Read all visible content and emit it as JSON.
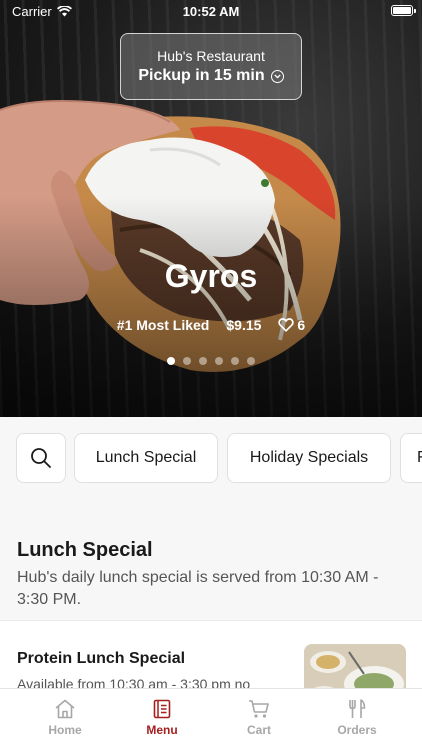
{
  "status_bar": {
    "carrier": "Carrier",
    "time": "10:52 AM"
  },
  "pickup": {
    "restaurant": "Hub's Restaurant",
    "label": "Pickup in 15 min"
  },
  "featured": {
    "name": "Gyros",
    "badge": "#1 Most Liked",
    "price": "$9.15",
    "likes": "6",
    "page_count": 6,
    "active_page": 1
  },
  "categories": {
    "search_icon": "search-icon",
    "items": [
      "Lunch Special",
      "Holiday Specials",
      "F"
    ]
  },
  "section": {
    "title": "Lunch Special",
    "description": "Hub's daily lunch special is served from 10:30 AM - 3:30 PM."
  },
  "item": {
    "name": "Protein Lunch Special",
    "subtitle": "Available from 10:30 am - 3:30 pm no"
  },
  "tabs": [
    {
      "label": "Home",
      "icon": "home-icon"
    },
    {
      "label": "Menu",
      "icon": "menu-icon"
    },
    {
      "label": "Cart",
      "icon": "cart-icon"
    },
    {
      "label": "Orders",
      "icon": "orders-icon"
    }
  ],
  "colors": {
    "accent": "#a51f1f",
    "inactive_tab": "#a7a7a7"
  }
}
